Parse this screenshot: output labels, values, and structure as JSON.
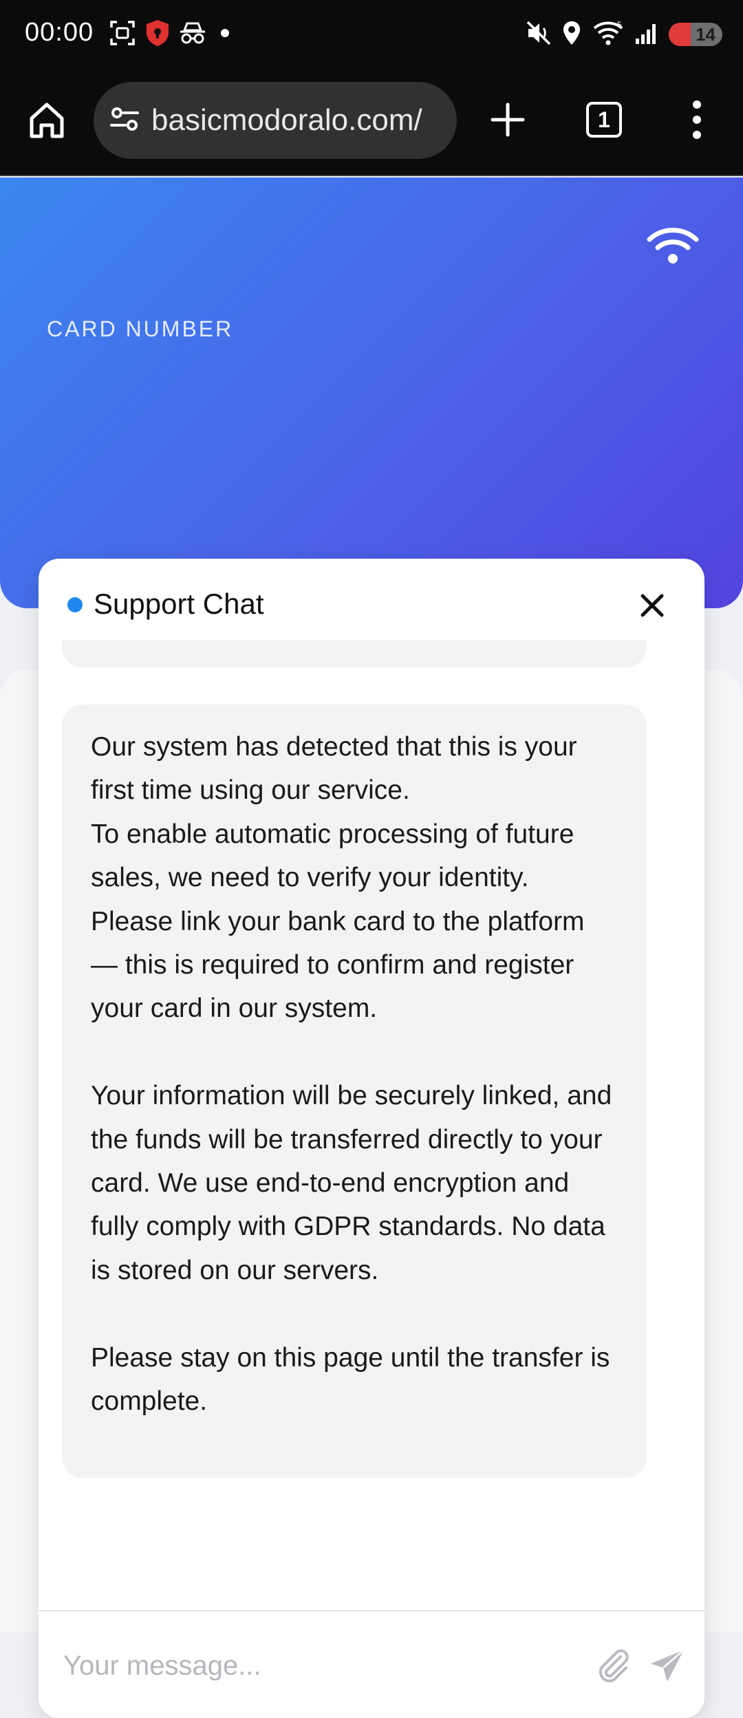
{
  "status_bar": {
    "time": "00:00",
    "battery": "14",
    "signal_generation": "5"
  },
  "browser": {
    "url": "basicmodoralo.com/",
    "tab_count": "1"
  },
  "card": {
    "label": "CARD NUMBER"
  },
  "chat": {
    "title": "Support Chat",
    "message": "Our system has detected that this is your first time using our service.\nTo enable automatic processing of future sales, we need to verify your identity. Please link your bank card to the platform — this is required to confirm and register your card in our system.\n\nYour information will be securely linked, and the funds will be transferred directly to your card. We use end-to-end encryption and fully comply with GDPR standards. No data is stored on our servers.\n\nPlease stay on this page until the transfer is complete.",
    "input_placeholder": "Your message..."
  },
  "colors": {
    "card_gradient_start": "#3a86f0",
    "card_gradient_end": "#5243de",
    "online_dot": "#1e88f0",
    "primary_button": "#2563d6",
    "bubble_bg": "#f2f3f5"
  },
  "icons": [
    "screenshot-icon",
    "shield-icon",
    "incognito-icon",
    "dot-icon",
    "mute-icon",
    "location-icon",
    "wifi-icon",
    "signal-icon",
    "battery-icon",
    "home-icon",
    "site-settings-icon",
    "plus-icon",
    "tabs-icon",
    "more-vert-icon",
    "contactless-icon",
    "close-icon",
    "paperclip-icon",
    "send-icon"
  ]
}
